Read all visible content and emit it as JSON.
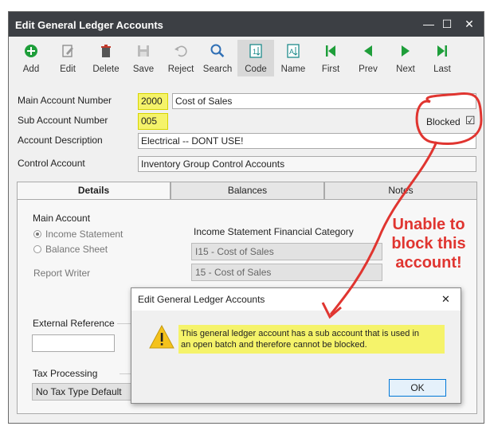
{
  "window": {
    "title": "Edit General Ledger Accounts",
    "minimize": "—",
    "maximize": "☐",
    "close": "✕"
  },
  "toolbar": {
    "add": "Add",
    "edit": "Edit",
    "delete": "Delete",
    "save": "Save",
    "reject": "Reject",
    "search": "Search",
    "code": "Code",
    "name": "Name",
    "first": "First",
    "prev": "Prev",
    "next": "Next",
    "last": "Last"
  },
  "form": {
    "main_account_label": "Main Account Number",
    "main_account_value": "2000",
    "main_account_name": "Cost of Sales",
    "sub_account_label": "Sub Account Number",
    "sub_account_value": "005",
    "blocked_label": "Blocked",
    "blocked_checked": "☑",
    "description_label": "Account Description",
    "description_value": "Electrical -- DONT USE!",
    "control_label": "Control Account",
    "control_value": "Inventory Group Control Accounts"
  },
  "tabs": [
    "Details",
    "Balances",
    "Notes"
  ],
  "details": {
    "main_account_heading": "Main Account",
    "income_statement": "Income Statement",
    "balance_sheet": "Balance Sheet",
    "report_writer": "Report Writer",
    "is_category_label": "Income Statement Financial Category",
    "is_category_value1": "I15 - Cost of Sales",
    "is_category_value2": "15 - Cost of Sales",
    "external_reference": "External Reference",
    "tax_processing": "Tax Processing",
    "tax_value": "No Tax Type Default"
  },
  "dialog": {
    "title": "Edit General Ledger Accounts",
    "close": "✕",
    "message_line1": "This general ledger account has a sub account that is used in",
    "message_line2": "an open batch and therefore cannot be blocked.",
    "ok": "OK"
  },
  "annotation": {
    "line1": "Unable to",
    "line2": "block this",
    "line3": "account!"
  },
  "colors": {
    "titlebar": "#3c3f44",
    "highlight": "#f5f36a",
    "annotation_red": "#e03530"
  }
}
